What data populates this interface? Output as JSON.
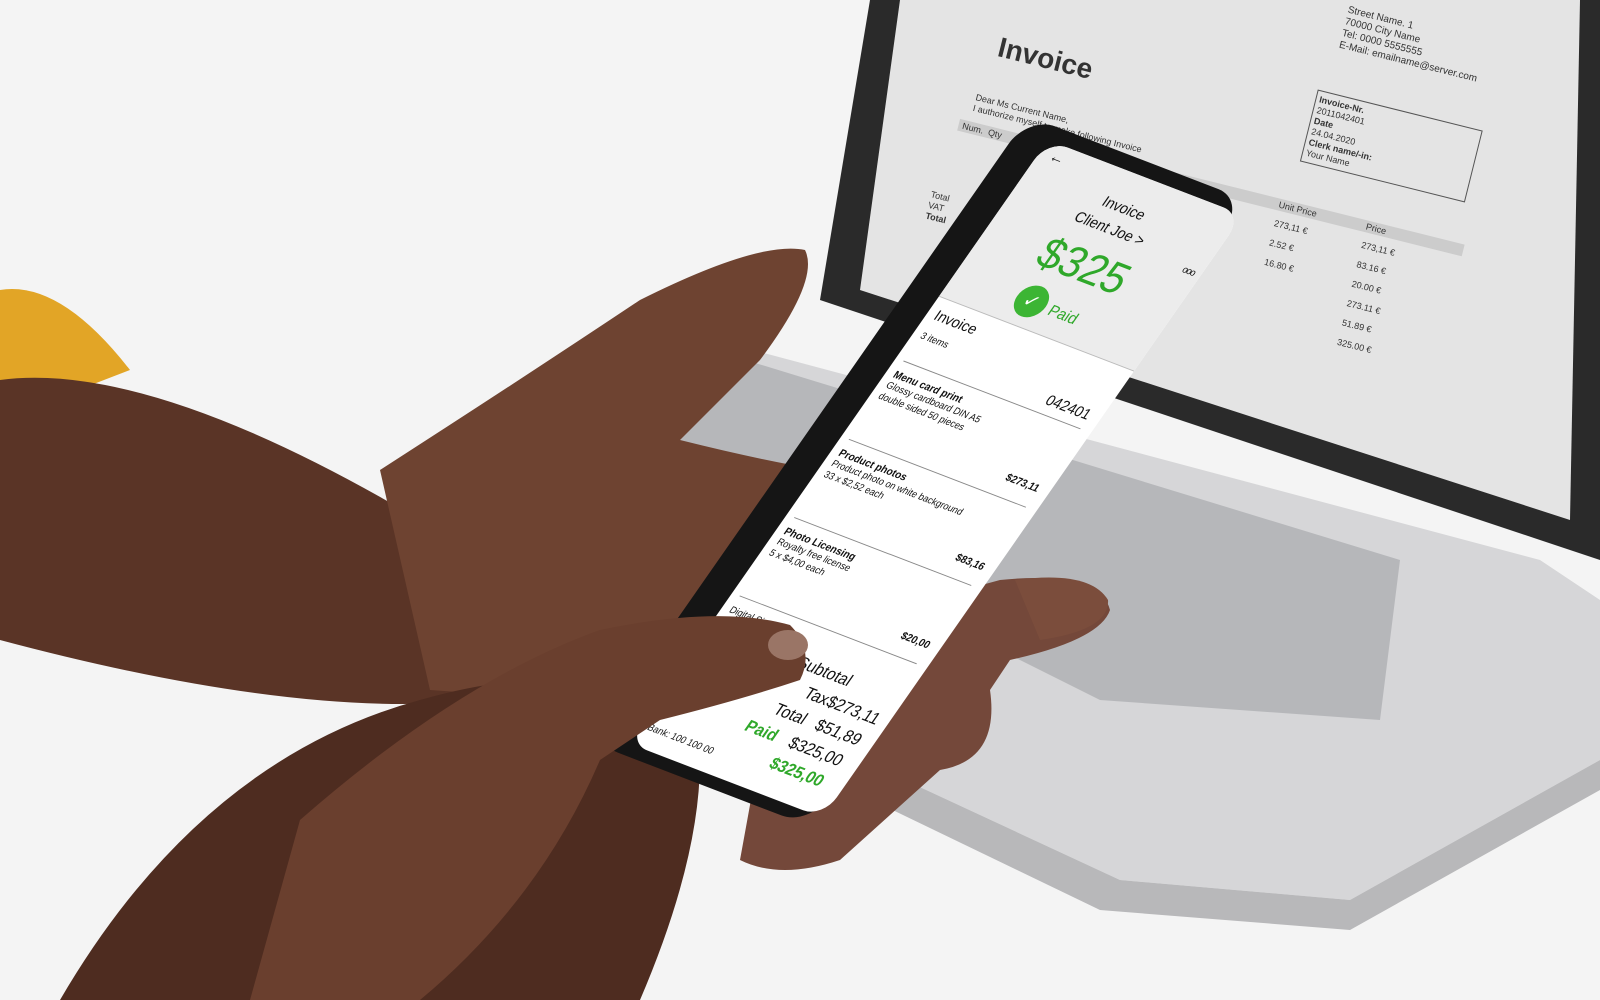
{
  "laptop_document": {
    "title": "Invoice",
    "address": [
      "Street Name. 1",
      "70000 City Name",
      "Tel: 0000 5555555",
      "E-Mail: emailname@server.com"
    ],
    "greeting": "Dear Ms Current Name,",
    "intro": "I authorize myself to make following Invoice",
    "invoice_nr_label": "Invoice-Nr.",
    "invoice_nr": "2011042401",
    "date_label": "Date",
    "date": "24.04.2020",
    "clerk_label": "Clerk name/-in:",
    "clerk": "Your Name",
    "columns": [
      "Num.",
      "Qty",
      "Unit Price",
      "Price"
    ],
    "unit_prices": [
      "273,11 €",
      "2.52 €",
      "16.80 €"
    ],
    "prices": [
      "273,11 €",
      "83.16 €",
      "20.00 €",
      "273.11 €",
      "51.89 €",
      "325.00 €"
    ],
    "summary_labels": [
      "Total",
      "VAT",
      "Total"
    ]
  },
  "phone": {
    "title": "Invoice",
    "client": "Client Joe >",
    "amount": "$325",
    "status": "Paid",
    "section_title": "Invoice",
    "item_count": "3 items",
    "invoice_number": "042401",
    "items": [
      {
        "name": "Menu card print",
        "desc1": "Glossy cardboard DIN A5",
        "desc2": "double sided 50 pieces",
        "price": "$273,11"
      },
      {
        "name": "Product photos",
        "desc1": "Product photo on white background",
        "desc2": "33 x $2,52 each",
        "price": "$83,16"
      },
      {
        "name": "Photo Licensing",
        "desc1": "Royalty free license",
        "desc2": "5 x $4,00 each",
        "price": "$20,00"
      }
    ],
    "signature_label": "Digital Signature",
    "subtotal_label": "Subtotal",
    "subtotal": "$273,11",
    "tax_label": "Tax",
    "tax": "$51,89",
    "total_label": "Total",
    "total": "$325,00",
    "paid_label": "Paid",
    "paid": "$325,00",
    "bank": "Bank: 100 100 00"
  },
  "colors": {
    "accent_green": "#2fa82a",
    "skin": "#6e4331",
    "sleeve": "#e2a526"
  }
}
